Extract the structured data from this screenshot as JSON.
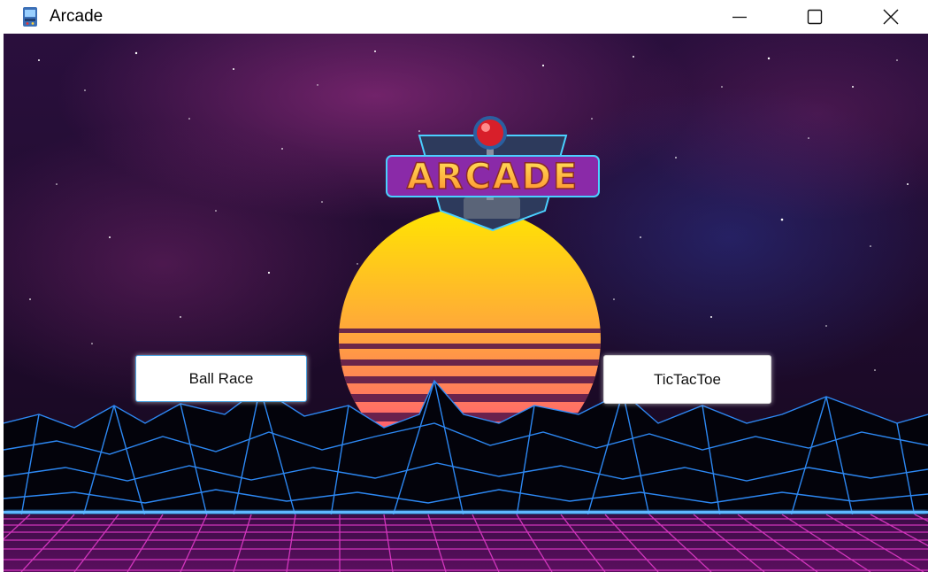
{
  "window": {
    "title": "Arcade",
    "app_icon": "arcade-cabinet-icon",
    "controls": [
      "minimize-icon",
      "maximize-icon",
      "close-icon"
    ]
  },
  "logo": {
    "text": "ARCADE"
  },
  "buttons": {
    "ball_race": "Ball Race",
    "tictactoe": "TicTacToe"
  },
  "colors": {
    "sky_top": "#1a0b2e",
    "nebula": "#5a1a5e",
    "sun_top": "#ffe600",
    "sun_bottom": "#ff3e8a",
    "mountain_line": "#2f8fff",
    "grid_floor": "#d42fb8"
  }
}
